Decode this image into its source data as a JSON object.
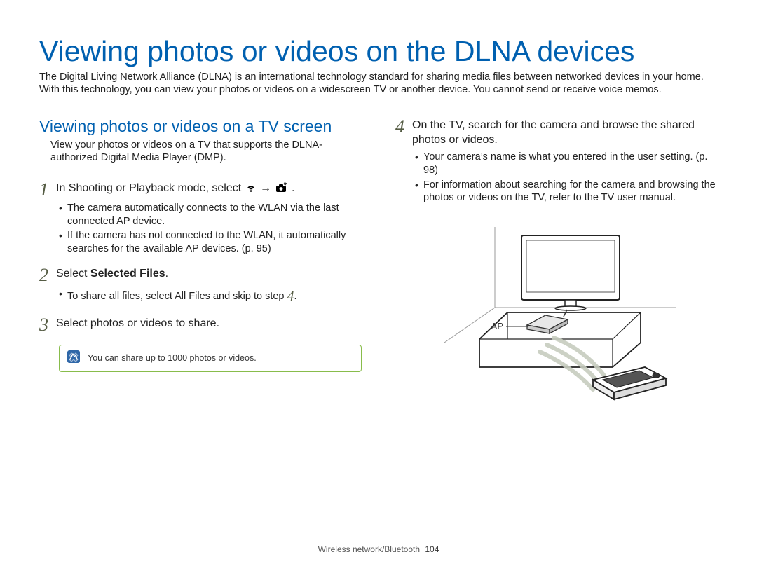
{
  "title": "Viewing photos or videos on the DLNA devices",
  "intro": "The Digital Living Network Alliance (DLNA) is an international technology standard for sharing media files between networked devices in your home. With this technology, you can view your photos or videos on a widescreen TV or another device. You cannot send or receive voice memos.",
  "subheading": "Viewing photos or videos on a TV screen",
  "subintro": "View your photos or videos on a TV that supports the DLNA-authorized Digital Media Player (DMP).",
  "steps": {
    "s1": {
      "num": "1",
      "body_pre": "In Shooting or Playback mode, select ",
      "arrow": "→",
      "body_post": " ."
    },
    "s1_bullets": [
      "The camera automatically connects to the WLAN via the last connected AP device.",
      "If the camera has not connected to the WLAN, it automatically searches for the available AP devices. (p. 95)"
    ],
    "s2": {
      "num": "2",
      "body_pre": "Select ",
      "bold": "Selected Files",
      "body_post": "."
    },
    "s2_bullets_pre": "To share all files, select ",
    "s2_bullets_bold": "All Files",
    "s2_bullets_mid": " and skip to step ",
    "s2_bullets_num": "4",
    "s2_bullets_post": ".",
    "s3": {
      "num": "3",
      "body": "Select photos or videos to share."
    },
    "s4": {
      "num": "4",
      "body": "On the TV, search for the camera and browse the shared photos or videos."
    },
    "s4_bullets": [
      "Your camera’s name is what you entered in the user setting. (p. 98)",
      "For information about searching for the camera and browsing the photos or videos on the TV, refer to the TV user manual."
    ]
  },
  "note": "You can share up to 1000 photos or videos.",
  "diagram_label": "AP",
  "footer_section": "Wireless network/Bluetooth",
  "footer_page": "104"
}
